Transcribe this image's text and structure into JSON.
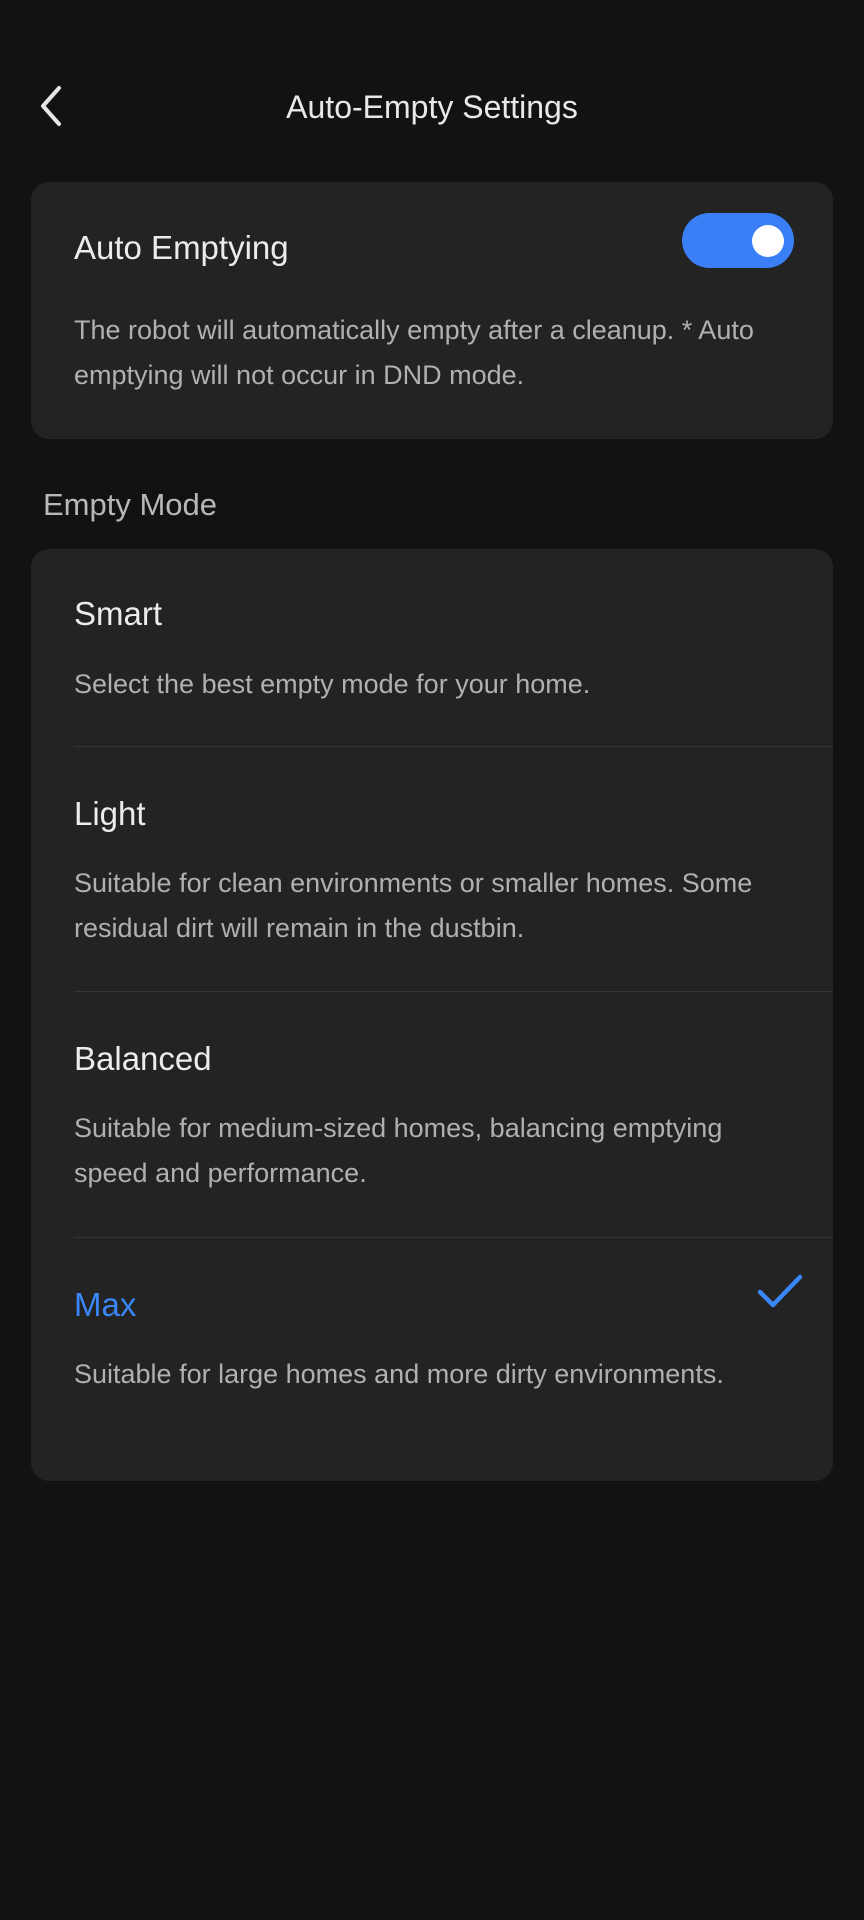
{
  "header": {
    "title": "Auto-Empty Settings",
    "back_icon": "chevron-left-icon"
  },
  "auto_empty": {
    "title": "Auto Emptying",
    "toggle_on": true,
    "description": "The robot will automatically empty after a cleanup. * Auto emptying will not occur in DND mode."
  },
  "empty_mode": {
    "section_label": "Empty Mode",
    "selected": "Max",
    "options": [
      {
        "label": "Smart",
        "description": "Select the best empty mode for your home."
      },
      {
        "label": "Light",
        "description": "Suitable for clean environments or smaller homes. Some residual dirt will remain in the dustbin."
      },
      {
        "label": "Balanced",
        "description": "Suitable for medium-sized homes, balancing emptying speed and performance."
      },
      {
        "label": "Max",
        "description": "Suitable for large homes and more dirty environments."
      }
    ]
  },
  "colors": {
    "background": "#121212",
    "card": "#232323",
    "accent": "#3a86f7"
  }
}
